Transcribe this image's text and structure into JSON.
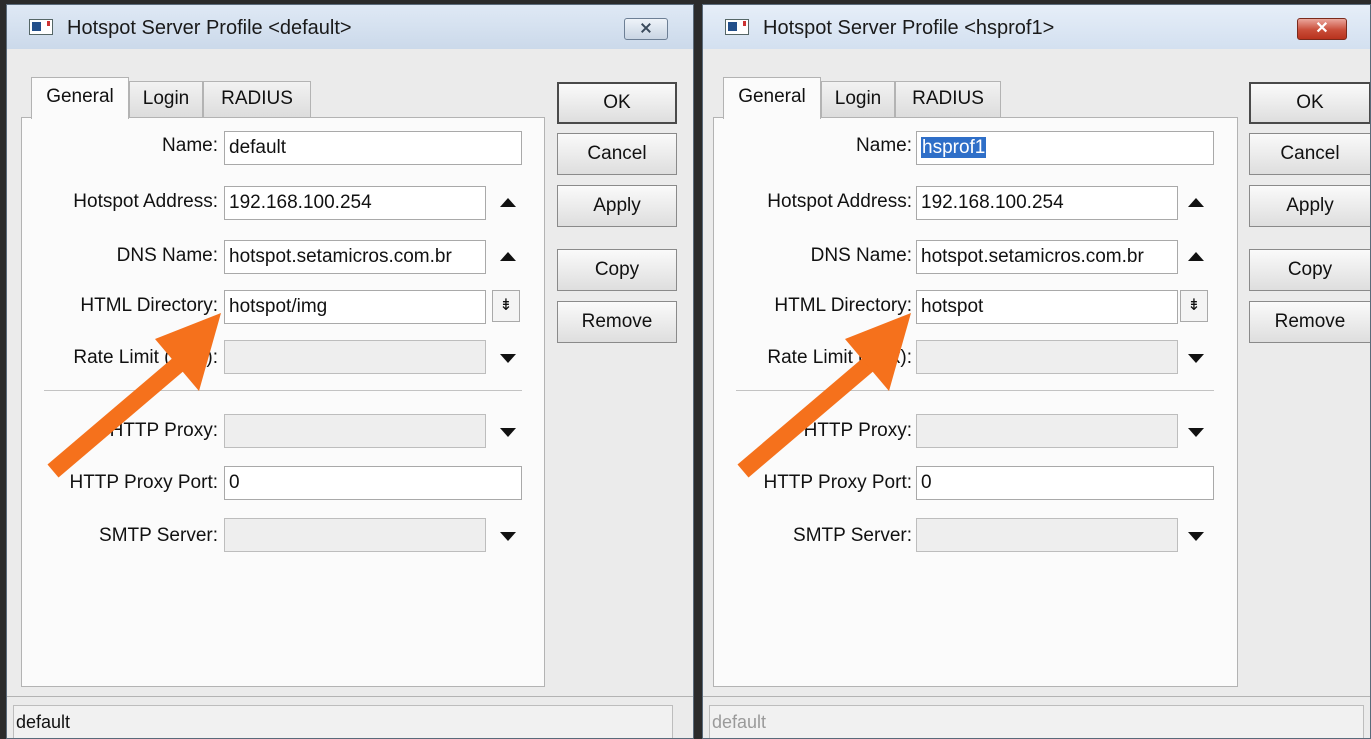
{
  "left": {
    "title": "Hotspot Server Profile <default>",
    "close_glyph": "⨯",
    "tabs": [
      "General",
      "Login",
      "RADIUS"
    ],
    "fields": {
      "name_label": "Name:",
      "name_value": "default",
      "address_label": "Hotspot Address:",
      "address_value": "192.168.100.254",
      "dns_label": "DNS Name:",
      "dns_value": "hotspot.setamicros.com.br",
      "html_label": "HTML Directory:",
      "html_value": "hotspot/img",
      "rate_label": "Rate Limit (rx/tx):",
      "rate_value": "",
      "proxy_label": "HTTP Proxy:",
      "proxy_value": "",
      "port_label": "HTTP Proxy Port:",
      "port_value": "0",
      "smtp_label": "SMTP Server:",
      "smtp_value": ""
    },
    "buttons": [
      "OK",
      "Cancel",
      "Apply",
      "Copy",
      "Remove"
    ],
    "status": "default"
  },
  "right": {
    "title": "Hotspot Server Profile <hsprof1>",
    "close_glyph": "✕",
    "tabs": [
      "General",
      "Login",
      "RADIUS"
    ],
    "fields": {
      "name_label": "Name:",
      "name_value": "hsprof1",
      "address_label": "Hotspot Address:",
      "address_value": "192.168.100.254",
      "dns_label": "DNS Name:",
      "dns_value": "hotspot.setamicros.com.br",
      "html_label": "HTML Directory:",
      "html_value": "hotspot",
      "rate_label": "Rate Limit (rx/tx):",
      "rate_value": "",
      "proxy_label": "HTTP Proxy:",
      "proxy_value": "",
      "port_label": "HTTP Proxy Port:",
      "port_value": "0",
      "smtp_label": "SMTP Server:",
      "smtp_value": ""
    },
    "buttons": [
      "OK",
      "Cancel",
      "Apply",
      "Copy",
      "Remove"
    ],
    "status": "default"
  },
  "colors": {
    "arrow": "#f5711c",
    "selection": "#2f6fc8"
  }
}
